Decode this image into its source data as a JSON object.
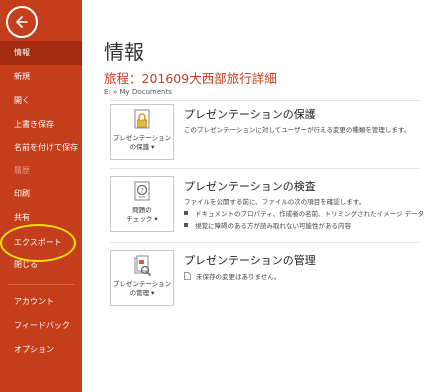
{
  "sidebar": {
    "items": [
      {
        "label": "情報"
      },
      {
        "label": "新規"
      },
      {
        "label": "開く"
      },
      {
        "label": "上書き保存"
      },
      {
        "label": "名前を付けて保存"
      },
      {
        "label": "履歴"
      },
      {
        "label": "印刷"
      },
      {
        "label": "共有"
      },
      {
        "label": "エクスポート"
      },
      {
        "label": "閉じる"
      },
      {
        "label": "アカウント"
      },
      {
        "label": "フィードバック"
      },
      {
        "label": "オプション"
      }
    ]
  },
  "main": {
    "page_title": "情報",
    "doc_title": "旅程：201609大西部旅行詳細",
    "path": "E: » My Documents",
    "sections": [
      {
        "button_line1": "プレゼンテーション",
        "button_line2": "の保護 ▾",
        "title": "プレゼンテーションの保護",
        "desc": "このプレゼンテーションに対してユーザーが行える変更の種類を管理します。"
      },
      {
        "button_line1": "問題の",
        "button_line2": "チェック ▾",
        "title": "プレゼンテーションの検査",
        "desc": "ファイルを公開する前に、ファイルの次の項目を確認します。",
        "bullets": [
          "ドキュメントのプロパティ、作成者の名前、トリミングされたイメージ データ",
          "視覚に障碍のある方が読み取れない可能性がある内容"
        ]
      },
      {
        "button_line1": "プレゼンテーション",
        "button_line2": "の管理 ▾",
        "title": "プレゼンテーションの管理",
        "desc": "未保存の変更はありません。"
      }
    ]
  },
  "colors": {
    "sidebar": "#c43e1c",
    "active": "#a22b10",
    "highlight": "#f5e100"
  }
}
